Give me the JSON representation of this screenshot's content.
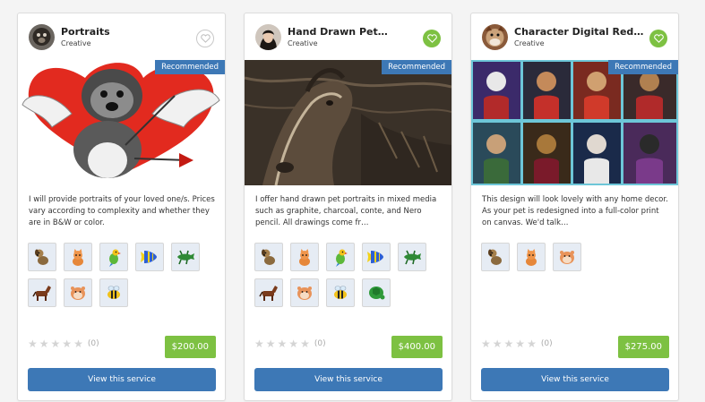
{
  "cards": [
    {
      "title": "Portraits",
      "category": "Creative",
      "badge": "Recommended",
      "favorited": false,
      "description": "I will provide portraits of your loved one/s. Prices vary according to complexity and whether they are in B&W or color.",
      "pets": [
        "dog-icon",
        "cat-icon",
        "bird-icon",
        "fish-icon",
        "reptile-icon",
        "horse-icon",
        "hamster-icon",
        "bee-icon"
      ],
      "rating": 0,
      "rating_count": "(0)",
      "price": "$200.00",
      "button": "View this service"
    },
    {
      "title": "Hand Drawn Pet…",
      "category": "Creative",
      "badge": "Recommended",
      "favorited": true,
      "description": "I offer hand drawn pet portraits in mixed media such as graphite, charcoal, conte, and Nero pencil. All drawings come fr…",
      "pets": [
        "dog-icon",
        "cat-icon",
        "bird-icon",
        "fish-icon",
        "reptile-icon",
        "horse-icon",
        "hamster-icon",
        "bee-icon",
        "turtle-icon"
      ],
      "rating": 0,
      "rating_count": "(0)",
      "price": "$400.00",
      "button": "View this service"
    },
    {
      "title": "Character Digital Redu…",
      "category": "Creative",
      "badge": "Recommended",
      "favorited": true,
      "description": "This design will look lovely with any home decor. As your pet is redesigned into a full-color print on canvas. We'd talk…",
      "pets": [
        "dog-icon",
        "cat-icon",
        "hamster-icon"
      ],
      "rating": 0,
      "rating_count": "(0)",
      "price": "$275.00",
      "button": "View this service"
    }
  ],
  "colors": {
    "accent_blue": "#3d78b6",
    "accent_green": "#7dc142",
    "star_empty": "#d4d4d4"
  }
}
